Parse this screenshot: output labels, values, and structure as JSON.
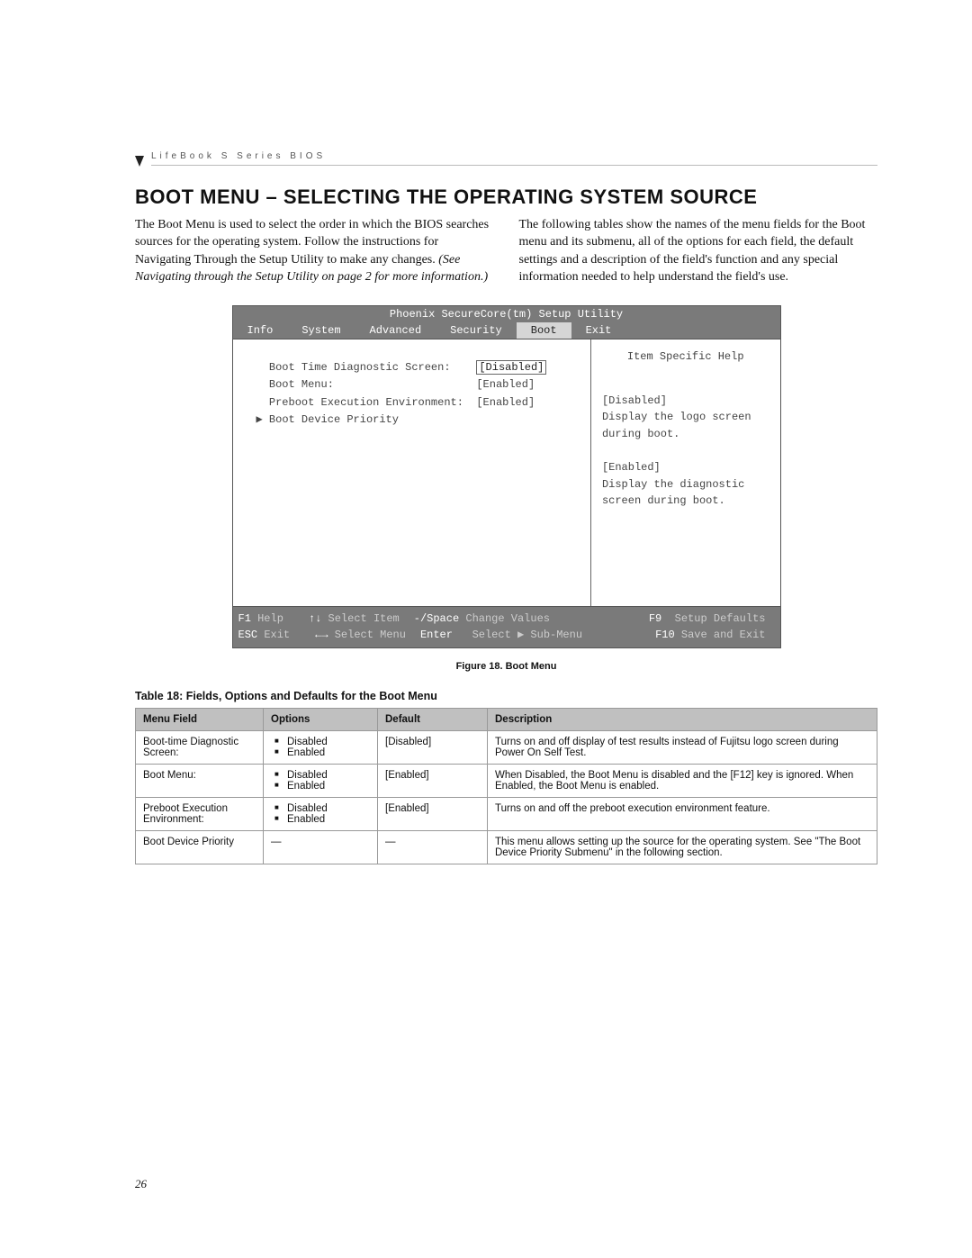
{
  "running_header": "LifeBook S Series BIOS",
  "title": "BOOT MENU – SELECTING THE OPERATING SYSTEM SOURCE",
  "intro_left_plain": "The Boot Menu is used to select the order in which the BIOS searches sources for the operating system. Follow the instructions for Navigating Through the Setup Utility to make any changes. ",
  "intro_left_italic": "(See Navigating through the Setup Utility on page 2 for more information.)",
  "intro_right": "The following tables show the names of the menu fields for the Boot menu and its submenu, all of the options for each field, the default settings and a description of the field's function and any special information needed to help understand the field's use.",
  "bios": {
    "title": "Phoenix SecureCore(tm) Setup Utility",
    "tabs": [
      "Info",
      "System",
      "Advanced",
      "Security",
      "Boot",
      "Exit"
    ],
    "active_tab": "Boot",
    "rows": [
      {
        "label": "Boot Time Diagnostic Screen:",
        "value": "[Disabled]",
        "selected": true
      },
      {
        "label": "Boot Menu:",
        "value": "[Enabled]",
        "selected": false
      },
      {
        "label": "Preboot Execution Environment:",
        "value": "[Enabled]",
        "selected": false
      },
      {
        "label": "Boot Device Priority",
        "value": "",
        "submenu": true
      }
    ],
    "help_title": "Item Specific Help",
    "help_body": "[Disabled]\nDisplay the logo screen during boot.\n\n[Enabled]\nDisplay the diagnostic screen during boot.",
    "footer": {
      "r1": {
        "k1": "F1",
        "v1": "Help",
        "k2": "↑↓",
        "v2": "Select Item",
        "k3": "-/Space",
        "v3": "Change Values",
        "k4": "F9",
        "v4": "Setup Defaults"
      },
      "r2": {
        "k1": "ESC",
        "v1": "Exit",
        "k2": "←→",
        "v2": "Select Menu",
        "k3": "Enter",
        "v3": "Select ▶ Sub-Menu",
        "k4": "F10",
        "v4": "Save and Exit"
      }
    }
  },
  "figure_caption": "Figure 18.  Boot Menu",
  "table_caption": "Table 18: Fields, Options and Defaults for the Boot Menu",
  "table": {
    "headers": [
      "Menu Field",
      "Options",
      "Default",
      "Description"
    ],
    "rows": [
      {
        "field": "Boot-time Diagnostic Screen:",
        "options": [
          "Disabled",
          "Enabled"
        ],
        "default": "[Disabled]",
        "desc": "Turns on and off display of test results instead of Fujitsu logo screen during Power On Self Test."
      },
      {
        "field": "Boot Menu:",
        "options": [
          "Disabled",
          "Enabled"
        ],
        "default": "[Enabled]",
        "desc": "When Disabled, the Boot Menu is disabled and the [F12] key is ignored. When Enabled, the Boot Menu is enabled."
      },
      {
        "field": "Preboot Execution Environment:",
        "options": [
          "Disabled",
          "Enabled"
        ],
        "default": "[Enabled]",
        "desc": "Turns on and off the preboot execution environment feature."
      },
      {
        "field": "Boot Device Priority",
        "options": [],
        "default": "—",
        "desc": "This menu allows setting up the source for the operating system. See \"The Boot Device Priority Submenu\" in the following section."
      }
    ]
  },
  "page_number": "26"
}
